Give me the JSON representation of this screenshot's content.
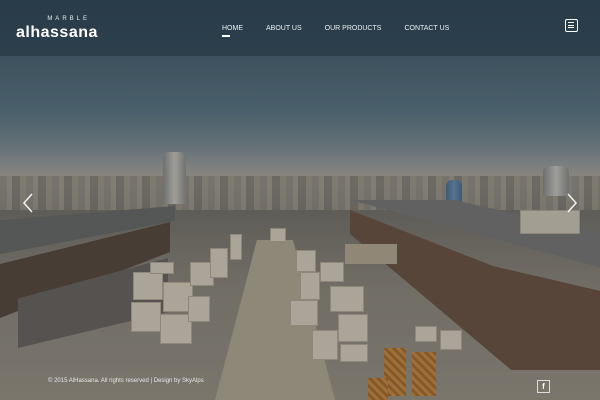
{
  "logo": {
    "top_text": "MARBLE",
    "main_text": "alhassana"
  },
  "nav": {
    "items": [
      {
        "label": "HOME",
        "active": true
      },
      {
        "label": "ABOUT US",
        "active": false
      },
      {
        "label": "OUR PRODUCTS",
        "active": false
      },
      {
        "label": "CONTACT US",
        "active": false
      }
    ]
  },
  "header": {
    "menu_icon": "menu-icon"
  },
  "slider": {
    "prev_icon": "chevron-left-icon",
    "next_icon": "chevron-right-icon"
  },
  "footer": {
    "copyright": "© 2015 AlHassana. All rights reserved | Design by SkyAlps",
    "facebook_label": "f"
  },
  "colors": {
    "header_bg": "#2c3e4a",
    "text": "#ffffff"
  }
}
